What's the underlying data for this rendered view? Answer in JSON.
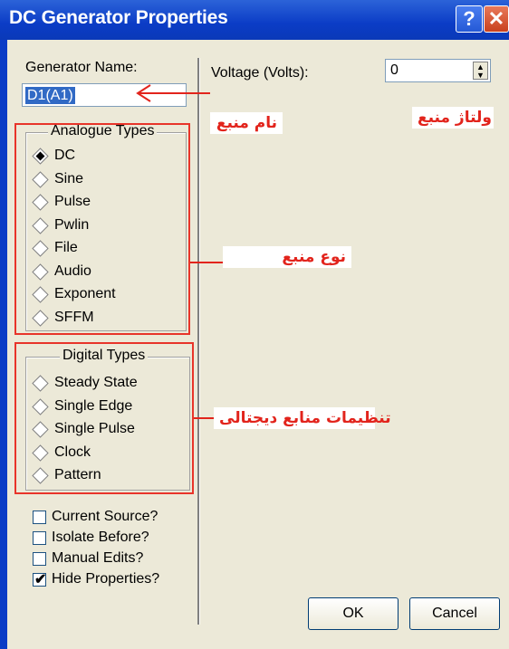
{
  "window": {
    "title": "DC Generator Properties",
    "help_glyph": "?",
    "close_glyph": "✕"
  },
  "left": {
    "generator_name_label": "Generator Name:",
    "generator_name_value": "D1(A1)",
    "analogue_types_label": "Analogue Types",
    "analogue_types": [
      {
        "label": "DC",
        "selected": true
      },
      {
        "label": "Sine",
        "selected": false
      },
      {
        "label": "Pulse",
        "selected": false
      },
      {
        "label": "Pwlin",
        "selected": false
      },
      {
        "label": "File",
        "selected": false
      },
      {
        "label": "Audio",
        "selected": false
      },
      {
        "label": "Exponent",
        "selected": false
      },
      {
        "label": "SFFM",
        "selected": false
      }
    ],
    "digital_types_label": "Digital Types",
    "digital_types": [
      {
        "label": "Steady State",
        "selected": false
      },
      {
        "label": "Single Edge",
        "selected": false
      },
      {
        "label": "Single Pulse",
        "selected": false
      },
      {
        "label": "Clock",
        "selected": false
      },
      {
        "label": "Pattern",
        "selected": false
      }
    ],
    "checkboxes": [
      {
        "label": "Current Source?",
        "checked": false
      },
      {
        "label": "Isolate Before?",
        "checked": false
      },
      {
        "label": "Manual Edits?",
        "checked": false
      },
      {
        "label": "Hide Properties?",
        "checked": true
      }
    ]
  },
  "right": {
    "voltage_label": "Voltage (Volts):",
    "voltage_value": "0"
  },
  "annotations": {
    "name": "نام منبع",
    "voltage": "ولتاژ منبع",
    "type": "نوع منبع",
    "digital": "تنظیمات منابع دیجتالی"
  },
  "buttons": {
    "ok": "OK",
    "cancel": "Cancel"
  },
  "colors": {
    "title_bar": "#0b3cc6",
    "dialog_bg": "#ece9d8",
    "annotation_red": "#e2241c",
    "selection_blue": "#316ac5"
  }
}
